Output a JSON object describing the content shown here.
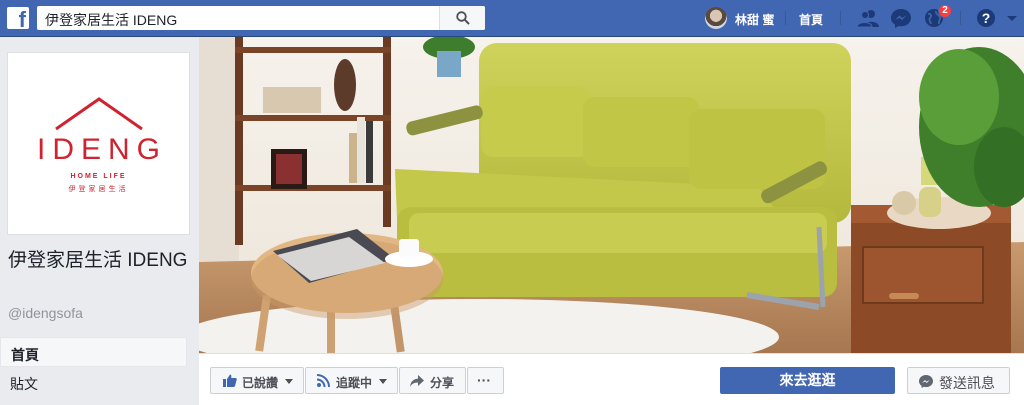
{
  "topbar": {
    "search_value": "伊登家居生活 IDENG",
    "user_name": "林甜 蜜",
    "home_label": "首頁",
    "notification_count": "2",
    "icons": [
      "facebook-logo",
      "search-icon",
      "friends-icon",
      "messenger-icon",
      "notifications-globe-icon",
      "help-icon"
    ]
  },
  "page": {
    "name": "伊登家居生活 IDENG",
    "handle": "@idengsofa",
    "logo_word": "IDENG",
    "logo_tagline": "HOME LIFE",
    "logo_tagline_cn": "伊登家居生活"
  },
  "nav": {
    "items": [
      {
        "label": "首頁",
        "active": true
      },
      {
        "label": "貼文",
        "active": false
      }
    ]
  },
  "actions": {
    "liked_label": "已說讚",
    "following_label": "追蹤中",
    "share_label": "分享",
    "more_label": "···",
    "primary_label": "來去逛逛",
    "message_label": "發送訊息"
  },
  "colors": {
    "brand_blue": "#4267b2",
    "logo_red": "#cf2430",
    "sofa_green": "#c3c84a"
  }
}
